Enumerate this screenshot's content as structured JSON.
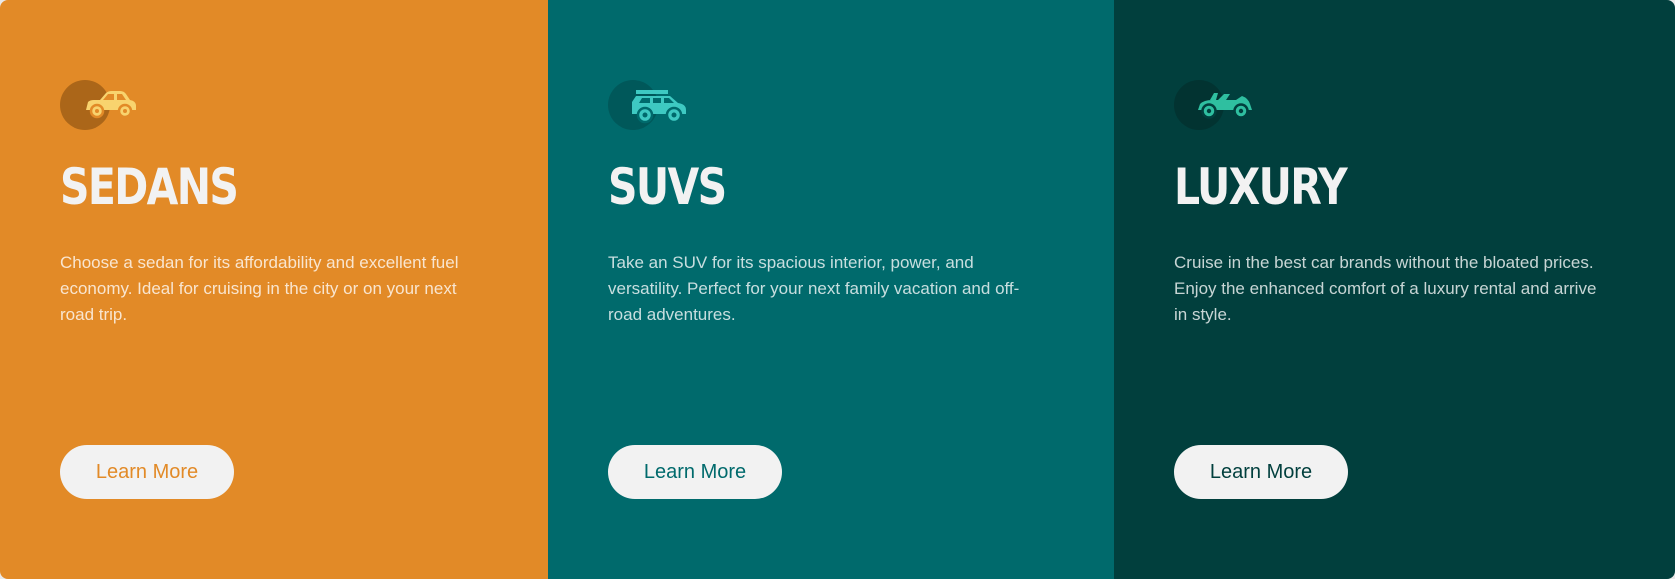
{
  "cards": [
    {
      "key": "sedans",
      "icon": "sedan-icon",
      "title": "SEDANS",
      "description": "Choose a sedan for its affordability and excellent fuel economy. Ideal for cruising in the city or on your next road trip.",
      "button_label": "Learn More",
      "bg_color": "#E28A27",
      "icon_color": "#F8D36E"
    },
    {
      "key": "suvs",
      "icon": "suv-icon",
      "title": "SUVS",
      "description": "Take an SUV for its spacious interior, power, and versatility. Perfect for your next family vacation and off-road adventures.",
      "button_label": "Learn More",
      "bg_color": "#006A6C",
      "icon_color": "#3EC9C2"
    },
    {
      "key": "luxury",
      "icon": "luxury-car-icon",
      "title": "LUXURY",
      "description": "Cruise in the best car brands without the bloated prices. Enjoy the enhanced comfort of a luxury rental and arrive in style.",
      "button_label": "Learn More",
      "bg_color": "#013F3D",
      "icon_color": "#2FBFA0"
    }
  ]
}
